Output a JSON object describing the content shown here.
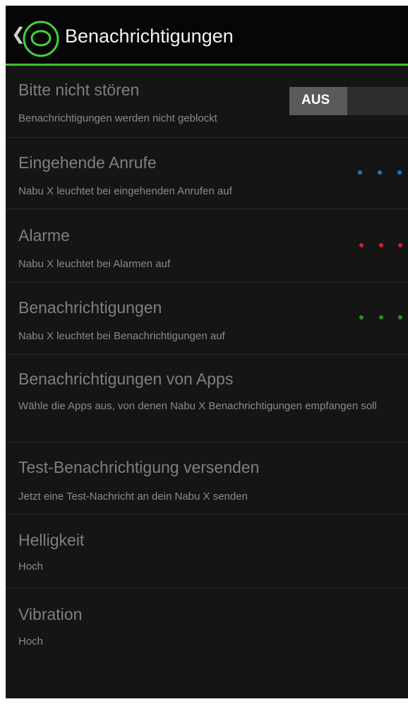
{
  "header": {
    "back_glyph": "❮",
    "title": "Benachrichtigungen",
    "accent_color": "#3fbf2f"
  },
  "dnd": {
    "title": "Bitte nicht stören",
    "subtitle": "Benachrichtigungen werden nicht geblockt",
    "toggle_label": "AUS"
  },
  "calls": {
    "title": "Eingehende Anrufe",
    "subtitle": "Nabu X leuchtet bei eingehenden Anrufen auf",
    "dot_color": "#1e78c8"
  },
  "alarms": {
    "title": "Alarme",
    "subtitle": "Nabu X leuchtet bei Alarmen auf",
    "dot_color": "#d81f1f"
  },
  "notifications": {
    "title": "Benachrichtigungen",
    "subtitle": "Nabu X leuchtet bei Benachrichtigungen auf",
    "dot_color": "#2f8f2a"
  },
  "app_notifications": {
    "title": "Benachrichtigungen von Apps",
    "subtitle": "Wähle die Apps aus, von denen Nabu X Benachrichtigungen empfangen soll"
  },
  "test_notification": {
    "title": "Test-Benachrichtigung versenden",
    "subtitle": "Jetzt eine Test-Nachricht an dein Nabu X senden"
  },
  "brightness": {
    "title": "Helligkeit",
    "value": "Hoch"
  },
  "vibration": {
    "title": "Vibration",
    "value": "Hoch"
  }
}
